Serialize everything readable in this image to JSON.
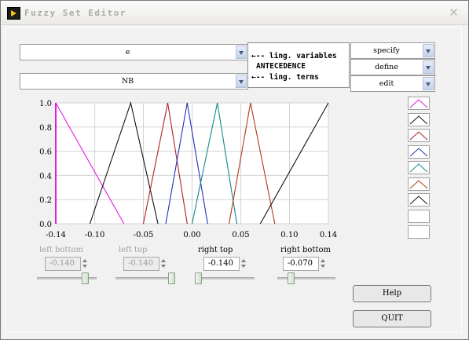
{
  "window": {
    "title": "Fuzzy Set Editor",
    "close_glyph": "✕"
  },
  "variable_select": {
    "value": "e"
  },
  "term_select": {
    "value": "NB"
  },
  "annotation": {
    "ling_variables": "←-- ling. variables",
    "antecedence": "ANTECEDENCE",
    "ling_terms": "←-- ling. terms"
  },
  "side_controls": {
    "specify": "specify",
    "define": "define",
    "edit": "edit"
  },
  "chart_data": {
    "type": "line",
    "xlim": [
      -0.14,
      0.14
    ],
    "ylim": [
      0,
      1
    ],
    "x_ticks": [
      "-0.14",
      "-0.10",
      "-0.05",
      "0.00",
      "0.05",
      "0.10",
      "0.14"
    ],
    "y_ticks": [
      "0.0",
      "0.2",
      "0.4",
      "0.6",
      "0.8",
      "1.0"
    ],
    "grid": true,
    "series": [
      {
        "color": "#e21be2",
        "points": [
          [
            -0.14,
            1.0
          ],
          [
            -0.14,
            1.0
          ],
          [
            -0.07,
            0.0
          ]
        ]
      },
      {
        "color": "#111111",
        "points": [
          [
            -0.105,
            0.0
          ],
          [
            -0.063,
            1.0
          ],
          [
            -0.035,
            0.0
          ]
        ]
      },
      {
        "color": "#b32020",
        "points": [
          [
            -0.05,
            0.0
          ],
          [
            -0.025,
            1.0
          ],
          [
            -0.005,
            0.0
          ]
        ]
      },
      {
        "color": "#2232b8",
        "points": [
          [
            -0.027,
            0.0
          ],
          [
            -0.005,
            1.0
          ],
          [
            0.016,
            0.0
          ]
        ]
      },
      {
        "color": "#118a8a",
        "points": [
          [
            0.0,
            0.0
          ],
          [
            0.026,
            1.0
          ],
          [
            0.046,
            0.0
          ]
        ]
      },
      {
        "color": "#b03a1a",
        "points": [
          [
            0.038,
            0.0
          ],
          [
            0.06,
            1.0
          ],
          [
            0.085,
            0.0
          ]
        ]
      },
      {
        "color": "#111111",
        "points": [
          [
            0.07,
            0.0
          ],
          [
            0.14,
            1.0
          ],
          [
            0.14,
            1.0
          ]
        ]
      }
    ]
  },
  "swatch_colors": [
    "#e21be2",
    "#111111",
    "#b32020",
    "#2232b8",
    "#118a8a",
    "#b03a1a",
    "#111111",
    "",
    ""
  ],
  "params": {
    "left_bottom": {
      "label": "left bottom",
      "value": "-0.140",
      "slider": 0.85
    },
    "left_top": {
      "label": "left top",
      "value": "-0.140",
      "slider": 1.0
    },
    "right_top": {
      "label": "right top",
      "value": "-0.140",
      "slider": 0.0
    },
    "right_bottom": {
      "label": "right bottom",
      "value": "-0.070",
      "slider": 0.2
    }
  },
  "buttons": {
    "help": "Help",
    "quit": "QUIT"
  }
}
